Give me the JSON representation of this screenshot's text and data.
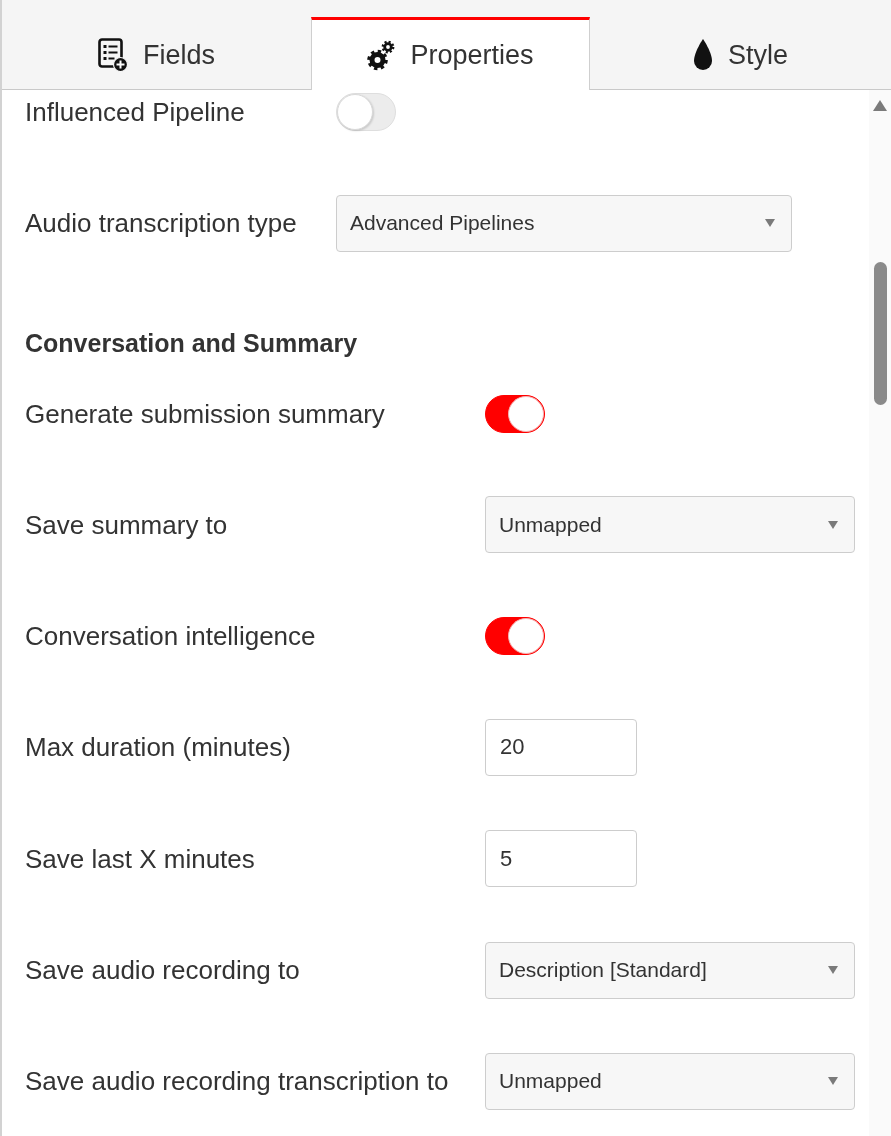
{
  "tabs": [
    {
      "label": "Fields",
      "selected": false
    },
    {
      "label": "Properties",
      "selected": true
    },
    {
      "label": "Style",
      "selected": false
    }
  ],
  "groups": [
    {
      "rows": [
        {
          "kind": "toggle",
          "label": "Influenced Pipeline",
          "on": false
        },
        {
          "kind": "select",
          "label": "Audio transcription type",
          "value": "Advanced Pipelines"
        }
      ]
    },
    {
      "title": "Conversation and Summary",
      "rows": [
        {
          "kind": "toggle",
          "label": "Generate submission summary",
          "on": true
        },
        {
          "kind": "select",
          "label": "Save summary to",
          "value": "Unmapped"
        },
        {
          "kind": "toggle",
          "label": "Conversation intelligence",
          "on": true
        },
        {
          "kind": "input",
          "label": "Max duration (minutes)",
          "value": "20"
        },
        {
          "kind": "input",
          "label": "Save last X minutes",
          "value": "5"
        },
        {
          "kind": "select",
          "label": "Save audio recording to",
          "value": "Description [Standard]"
        },
        {
          "kind": "select",
          "label": "Save audio recording transcription to",
          "value": "Unmapped"
        }
      ]
    }
  ]
}
